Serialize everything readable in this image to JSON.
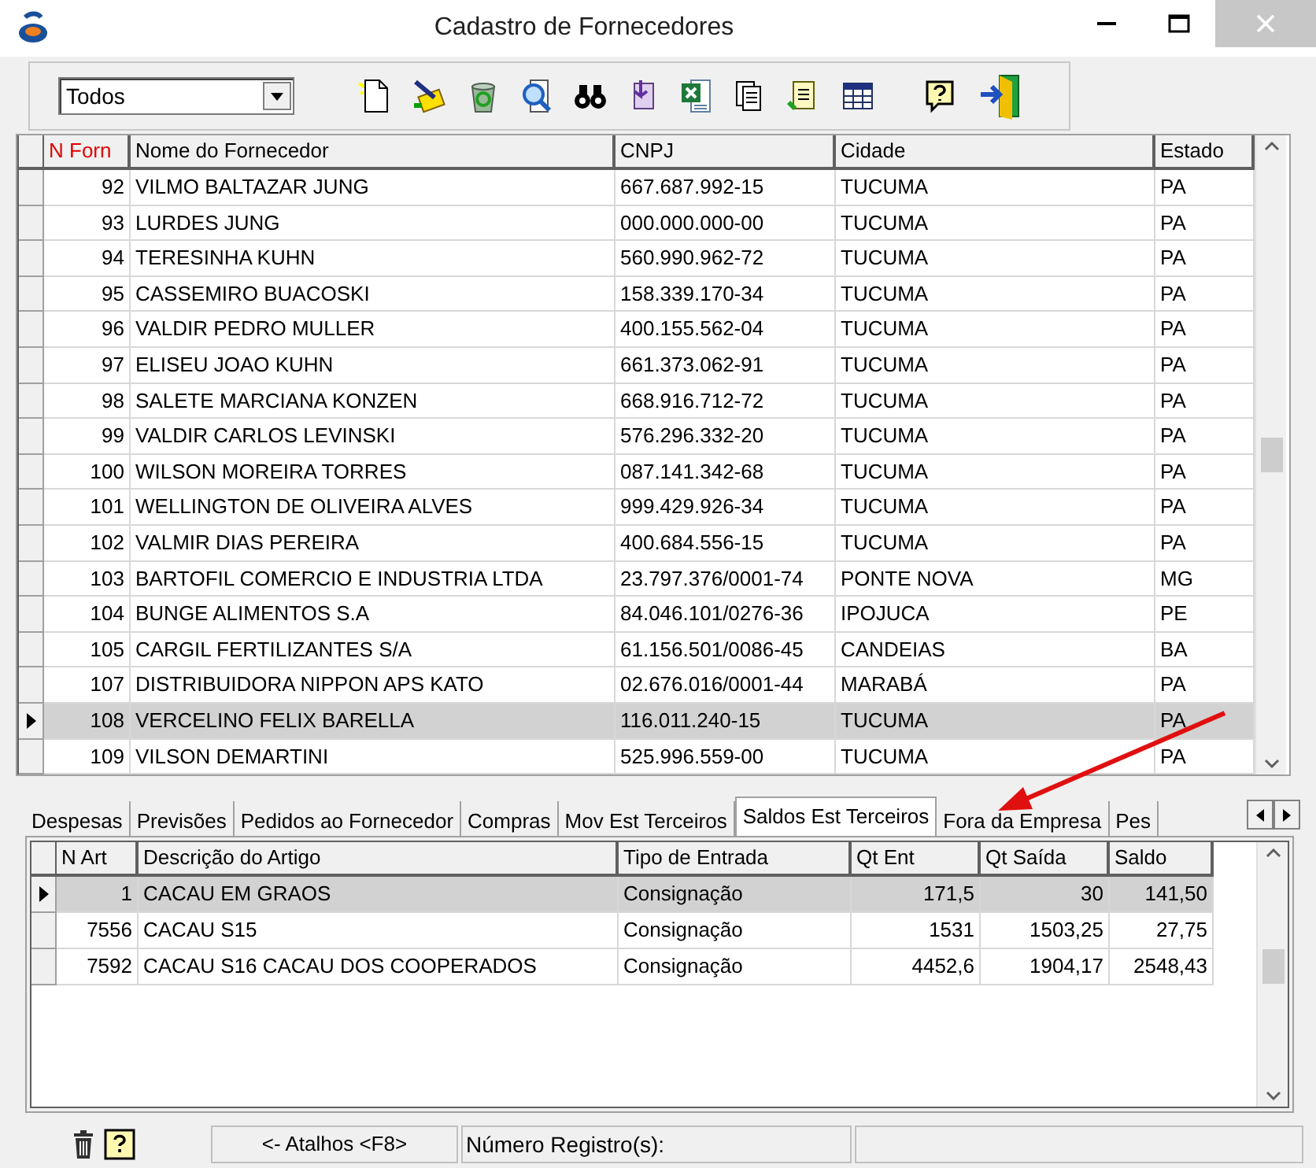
{
  "window": {
    "title": "Cadastro de Fornecedores"
  },
  "filter": {
    "value": "Todos"
  },
  "suppliers": {
    "columns": [
      {
        "label": "N Forn",
        "sorted": true,
        "kind": "number"
      },
      {
        "label": "Nome do Fornecedor",
        "sorted": false,
        "kind": "text"
      },
      {
        "label": "CNPJ",
        "sorted": false,
        "kind": "text"
      },
      {
        "label": "Cidade",
        "sorted": false,
        "kind": "text"
      },
      {
        "label": "Estado",
        "sorted": false,
        "kind": "text"
      }
    ],
    "rows": [
      {
        "cells": [
          "92",
          "VILMO BALTAZAR JUNG",
          "667.687.992-15",
          "TUCUMA",
          "PA"
        ],
        "selected": false
      },
      {
        "cells": [
          "93",
          "LURDES JUNG",
          "000.000.000-00",
          "TUCUMA",
          "PA"
        ],
        "selected": false
      },
      {
        "cells": [
          "94",
          "TERESINHA KUHN",
          "560.990.962-72",
          "TUCUMA",
          "PA"
        ],
        "selected": false
      },
      {
        "cells": [
          "95",
          "CASSEMIRO BUACOSKI",
          "158.339.170-34",
          "TUCUMA",
          "PA"
        ],
        "selected": false
      },
      {
        "cells": [
          "96",
          "VALDIR PEDRO MULLER",
          "400.155.562-04",
          "TUCUMA",
          "PA"
        ],
        "selected": false
      },
      {
        "cells": [
          "97",
          "ELISEU JOAO KUHN",
          "661.373.062-91",
          "TUCUMA",
          "PA"
        ],
        "selected": false
      },
      {
        "cells": [
          "98",
          "SALETE MARCIANA KONZEN",
          "668.916.712-72",
          "TUCUMA",
          "PA"
        ],
        "selected": false
      },
      {
        "cells": [
          "99",
          "VALDIR CARLOS LEVINSKI",
          "576.296.332-20",
          "TUCUMA",
          "PA"
        ],
        "selected": false
      },
      {
        "cells": [
          "100",
          "WILSON MOREIRA TORRES",
          "087.141.342-68",
          "TUCUMA",
          "PA"
        ],
        "selected": false
      },
      {
        "cells": [
          "101",
          "WELLINGTON DE OLIVEIRA ALVES",
          "999.429.926-34",
          "TUCUMA",
          "PA"
        ],
        "selected": false
      },
      {
        "cells": [
          "102",
          "VALMIR DIAS PEREIRA",
          "400.684.556-15",
          "TUCUMA",
          "PA"
        ],
        "selected": false
      },
      {
        "cells": [
          "103",
          "BARTOFIL COMERCIO E INDUSTRIA LTDA",
          "23.797.376/0001-74",
          "PONTE NOVA",
          "MG"
        ],
        "selected": false
      },
      {
        "cells": [
          "104",
          "BUNGE ALIMENTOS S.A",
          "84.046.101/0276-36",
          "IPOJUCA",
          "PE"
        ],
        "selected": false
      },
      {
        "cells": [
          "105",
          "CARGIL FERTILIZANTES S/A",
          "61.156.501/0086-45",
          "CANDEIAS",
          "BA"
        ],
        "selected": false
      },
      {
        "cells": [
          "107",
          "DISTRIBUIDORA NIPPON APS KATO",
          "02.676.016/0001-44",
          "MARABÁ",
          "PA"
        ],
        "selected": false
      },
      {
        "cells": [
          "108",
          "VERCELINO FELIX BARELLA",
          "116.011.240-15",
          "TUCUMA",
          "PA"
        ],
        "selected": true
      },
      {
        "cells": [
          "109",
          "VILSON DEMARTINI",
          "525.996.559-00",
          "TUCUMA",
          "PA"
        ],
        "selected": false
      }
    ]
  },
  "tabs": [
    {
      "label": "Despesas",
      "selected": false
    },
    {
      "label": "Previsões",
      "selected": false
    },
    {
      "label": "Pedidos ao Fornecedor",
      "selected": false
    },
    {
      "label": "Compras",
      "selected": false
    },
    {
      "label": "Mov Est Terceiros",
      "selected": false
    },
    {
      "label": "Saldos Est Terceiros",
      "selected": true
    },
    {
      "label": "Fora da Empresa",
      "selected": false
    },
    {
      "label": "Pes",
      "selected": false
    }
  ],
  "articles": {
    "columns": [
      {
        "label": "N Art",
        "kind": "number"
      },
      {
        "label": "Descrição do Artigo",
        "kind": "text"
      },
      {
        "label": "Tipo de Entrada",
        "kind": "text"
      },
      {
        "label": "Qt Ent",
        "kind": "number"
      },
      {
        "label": "Qt Saída",
        "kind": "number"
      },
      {
        "label": "Saldo",
        "kind": "number"
      }
    ],
    "rows": [
      {
        "cells": [
          "1",
          "CACAU EM GRAOS",
          "Consignação",
          "171,5",
          "30",
          "141,50"
        ],
        "selected": true
      },
      {
        "cells": [
          "7556",
          "CACAU S15",
          "Consignação",
          "1531",
          "1503,25",
          "27,75"
        ],
        "selected": false
      },
      {
        "cells": [
          "7592",
          "CACAU S16 CACAU DOS COOPERADOS",
          "Consignação",
          "4452,6",
          "1904,17",
          "2548,43"
        ],
        "selected": false
      }
    ]
  },
  "status_bar": {
    "shortcuts": "<- Atalhos <F8>",
    "records_label": "Número Registro(s):"
  }
}
